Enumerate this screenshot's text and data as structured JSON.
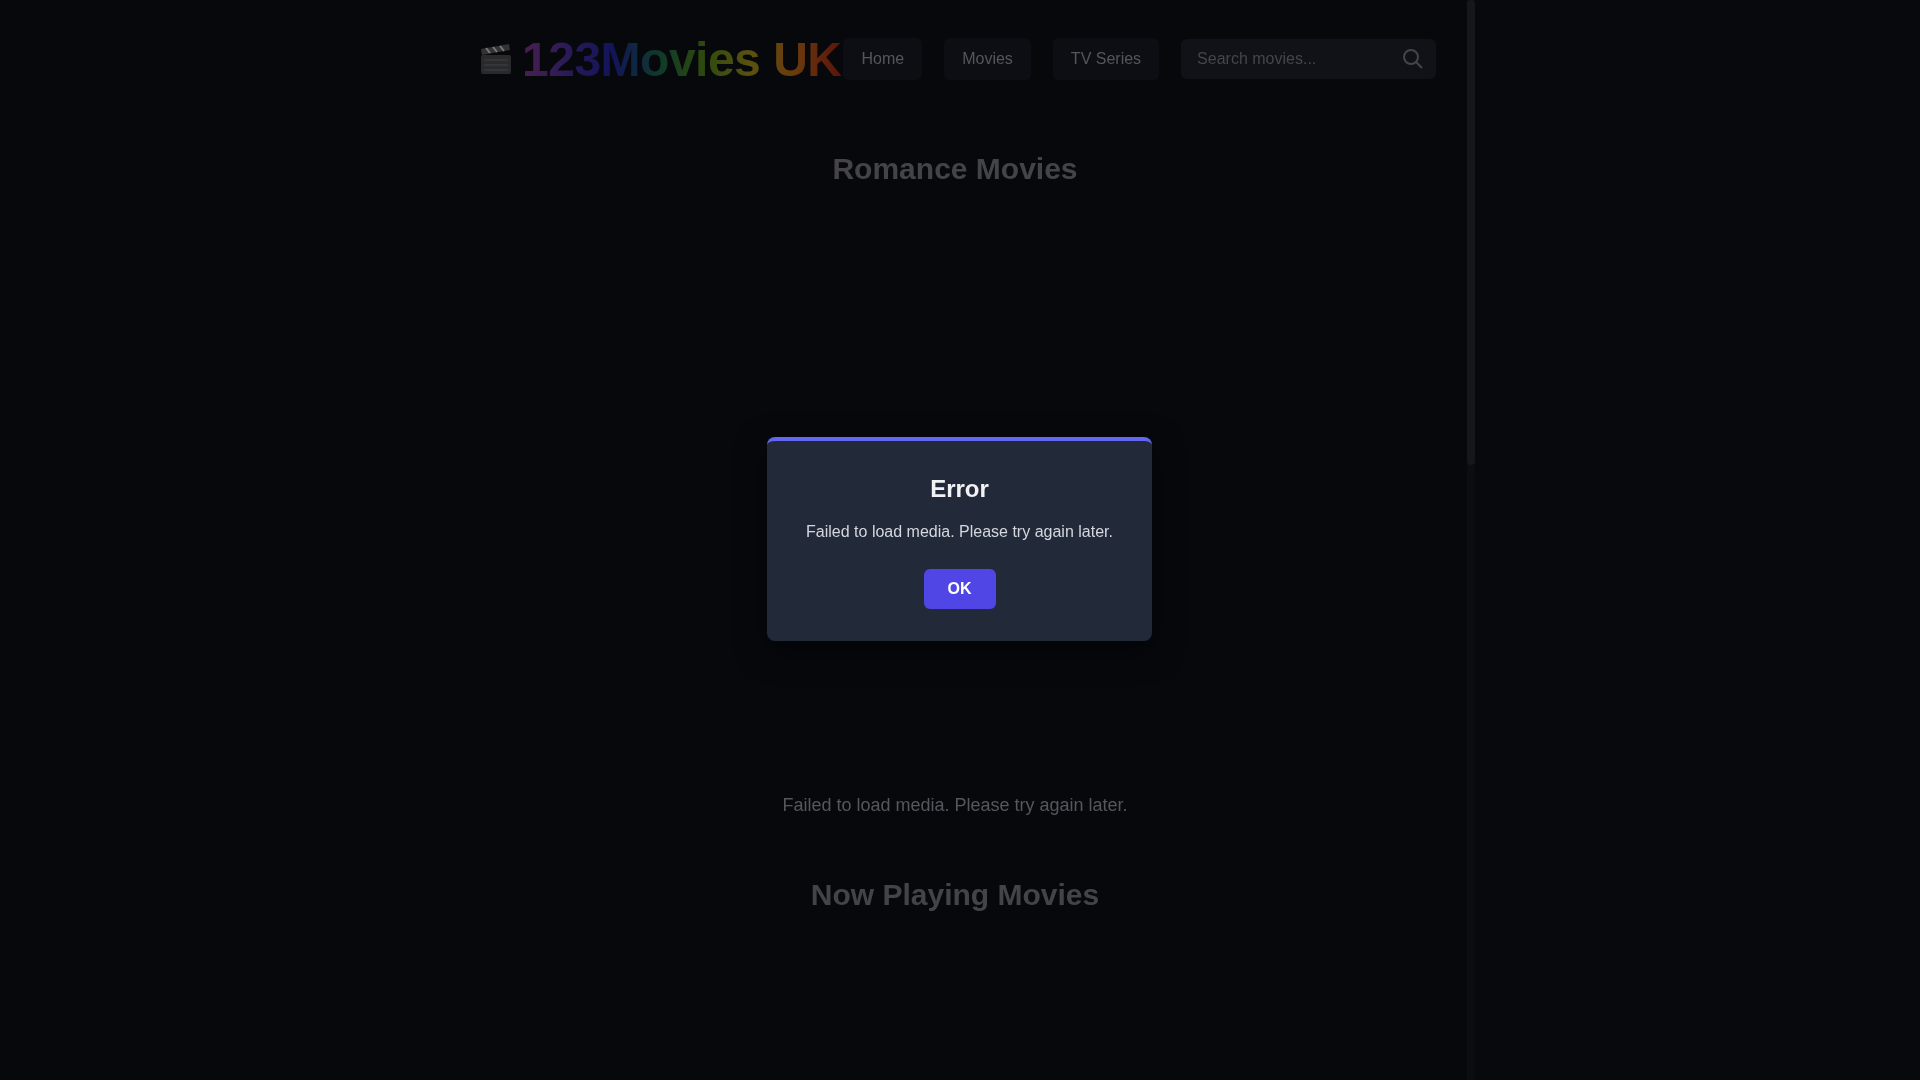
{
  "header": {
    "logo": "123Movies UK",
    "nav": [
      {
        "label": "Home"
      },
      {
        "label": "Movies"
      },
      {
        "label": "TV Series"
      }
    ],
    "search": {
      "placeholder": "Search movies..."
    }
  },
  "sections": [
    {
      "title": "Romance Movies",
      "message": "Failed to load media. Please try again later."
    },
    {
      "title": "Now Playing Movies"
    }
  ],
  "dialog": {
    "title": "Error",
    "message": "Failed to load media. Please try again later.",
    "button": "OK"
  }
}
